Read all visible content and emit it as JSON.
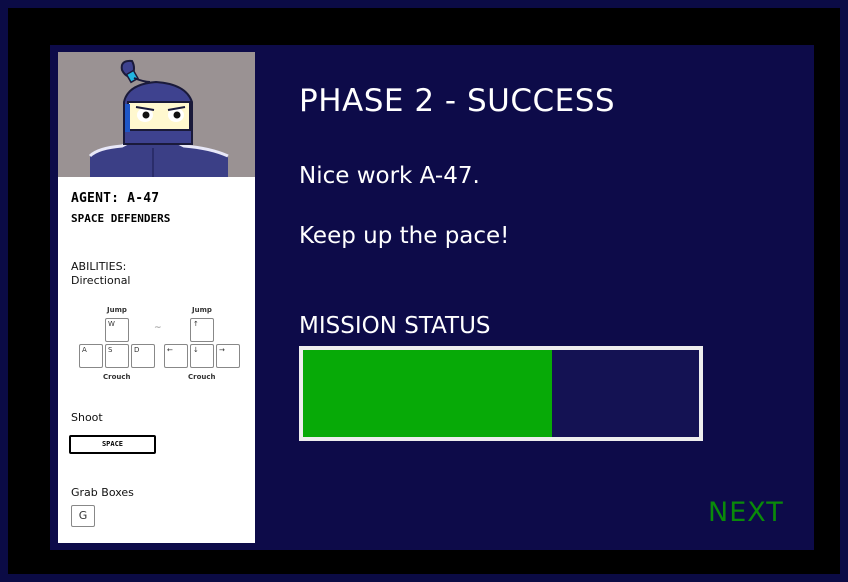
{
  "colors": {
    "progress_fill": "#07aa07",
    "next": "#0a8a0a"
  },
  "agent": {
    "name": "AGENT: A-47",
    "team": "SPACE DEFENDERS"
  },
  "abilities": {
    "title": "ABILITIES:",
    "subtitle": "Directional",
    "wasd": {
      "up": "W",
      "left": "A",
      "down": "S",
      "right": "D",
      "top_label": "Jump",
      "bottom_label": "Crouch"
    },
    "arrows": {
      "up": "↑",
      "left": "←",
      "down": "↓",
      "right": "→",
      "top_label": "Jump",
      "bottom_label": "Crouch"
    },
    "separator": "~"
  },
  "shoot": {
    "label": "Shoot",
    "key": "SPACE"
  },
  "grab": {
    "label": "Grab Boxes",
    "key": "G"
  },
  "main": {
    "title": "PHASE 2 - SUCCESS",
    "message_1": "Nice work A-47.",
    "message_2": "Keep up the pace!",
    "status_label": "MISSION STATUS",
    "progress_fraction": 0.63,
    "next_label": "NEXT"
  }
}
